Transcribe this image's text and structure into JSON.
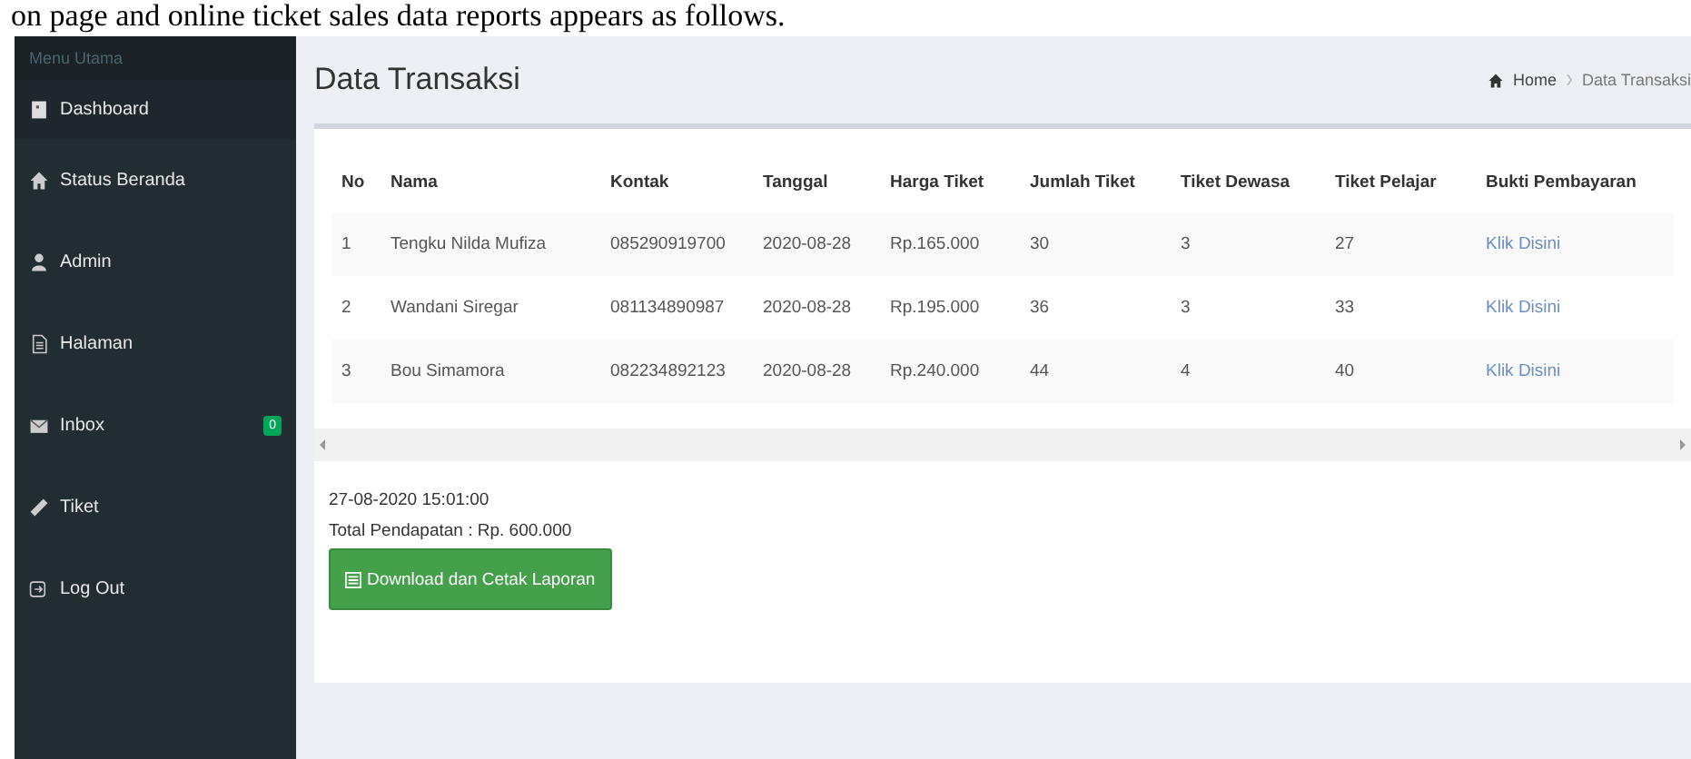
{
  "caption": "on page and online ticket sales data reports appears as follows.",
  "sidebar": {
    "header": "Menu Utama",
    "items": [
      {
        "label": "Dashboard",
        "kind": "dashboard",
        "selected": true
      },
      {
        "label": "Status Beranda",
        "kind": "home",
        "selected": false
      },
      {
        "label": "Admin",
        "kind": "user",
        "selected": false
      },
      {
        "label": "Halaman",
        "kind": "file",
        "selected": false
      },
      {
        "label": "Inbox",
        "kind": "mail",
        "selected": false,
        "badge": "0"
      },
      {
        "label": "Tiket",
        "kind": "ticket",
        "selected": false
      },
      {
        "label": "Log Out",
        "kind": "logout",
        "selected": false
      }
    ]
  },
  "page_title": "Data Transaksi",
  "breadcrumb": [
    "Home",
    "Data Transaksi"
  ],
  "table": {
    "columns": [
      "No",
      "Nama",
      "Kontak",
      "Tanggal",
      "Harga Tiket",
      "Jumlah Tiket",
      "Tiket Dewasa",
      "Tiket Pelajar",
      "Bukti Pembayaran"
    ],
    "rows": [
      [
        "1",
        "Tengku Nilda Mufiza",
        "085290919700",
        "2020-08-28",
        "Rp.165.000",
        "30",
        "3",
        "27",
        "Klik Disini"
      ],
      [
        "2",
        "Wandani Siregar",
        "081134890987",
        "2020-08-28",
        "Rp.195.000",
        "36",
        "3",
        "33",
        "Klik Disini"
      ],
      [
        "3",
        "Bou Simamora",
        "082234892123",
        "2020-08-28",
        "Rp.240.000",
        "44",
        "4",
        "40",
        "Klik Disini"
      ]
    ]
  },
  "report_time": "27-08-2020 15:01:00",
  "total": "Total Pendapatan : Rp. 600.000",
  "download_button": "Download dan Cetak Laporan"
}
